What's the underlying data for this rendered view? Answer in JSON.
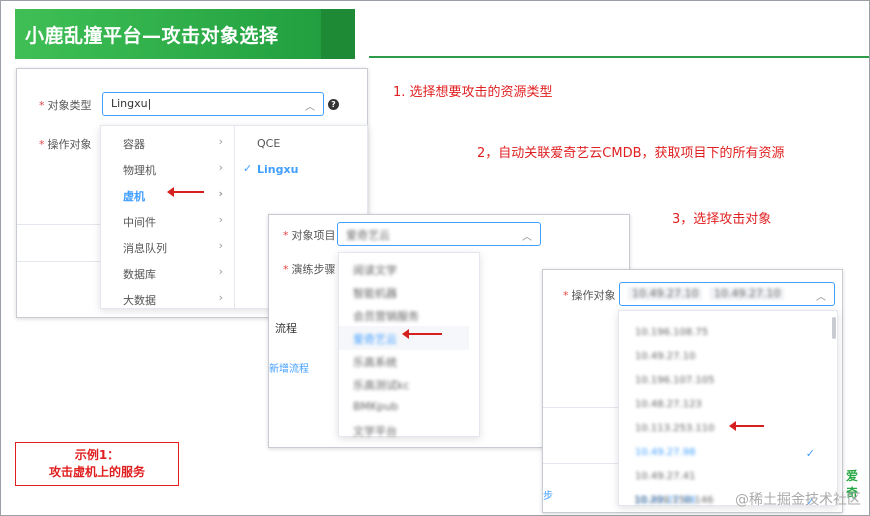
{
  "banner": {
    "title": "小鹿乱撞平台—攻击对象选择"
  },
  "panel1": {
    "object_type_label": "对象类型",
    "object_type_value": "Lingxu",
    "operation_target_label": "操作对象",
    "cascader_level1": [
      "容器",
      "物理机",
      "虚机",
      "中间件",
      "消息队列",
      "数据库",
      "大数据"
    ],
    "cascader_level1_active": "虚机",
    "cascader_level2": [
      "QCE",
      "Lingxu"
    ],
    "cascader_level2_active": "Lingxu"
  },
  "panel2": {
    "object_project_label": "对象项目",
    "object_project_value": "爱奇艺云",
    "drill_steps_label": "演练步骤",
    "flow_label": "流程",
    "add_flow_link": "新增流程",
    "options": [
      "阅读文学",
      "智能机器",
      "会员营销服务",
      "爱奇艺云",
      "乐高系统",
      "乐高测试kc",
      "BMKpub",
      "文学平台"
    ],
    "active_index": 3
  },
  "panel3": {
    "operation_target_label": "操作对象",
    "selected_tags": [
      "10.49.27.10",
      "10.49.27.10"
    ],
    "ips": [
      "10.196.108.75",
      "10.49.27.10",
      "10.196.107.105",
      "10.48.27.123",
      "10.113.253.110",
      "10.49.27.98",
      "10.49.27.41",
      "10.49.27.98",
      "10.209.150.146"
    ],
    "checked_indices": [
      5,
      7
    ],
    "next_button_fragment": "步"
  },
  "annotations": {
    "step1": "1. 选择想要攻击的资源类型",
    "step2": "2，自动关联爱奇艺云CMDB，获取项目下的所有资源",
    "step3": "3，选择攻击对象"
  },
  "example": {
    "line1": "示例1：",
    "line2": "攻击虚机上的服务"
  },
  "partial_text": "爱奇",
  "watermark": "@稀土掘金技术社区",
  "colors": {
    "accent": "#409eff",
    "green": "#28a745",
    "annotation_red": "#e02020"
  }
}
